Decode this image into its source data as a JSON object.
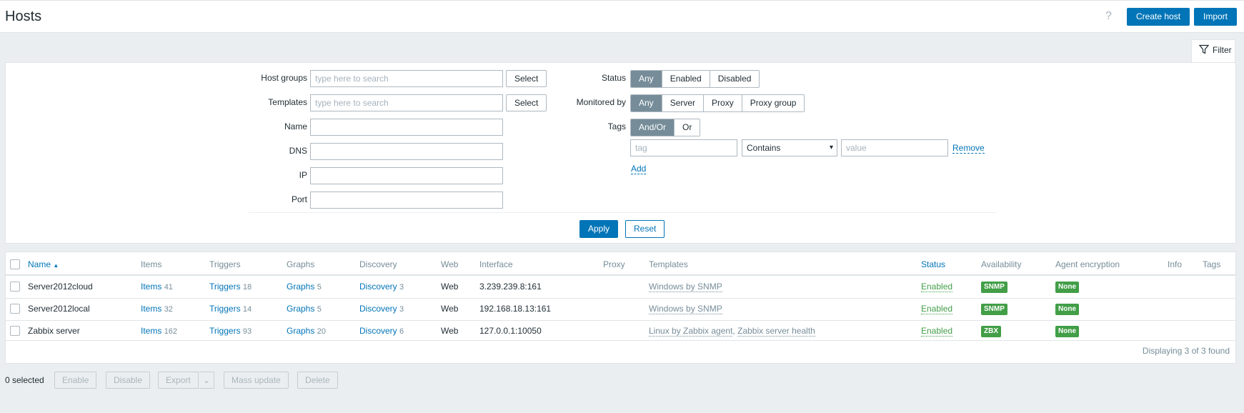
{
  "header": {
    "title": "Hosts",
    "help_glyph": "?",
    "create_host_label": "Create host",
    "import_label": "Import"
  },
  "filter_tab": {
    "label": "Filter"
  },
  "filter": {
    "host_groups_label": "Host groups",
    "host_groups_placeholder": "type here to search",
    "templates_label": "Templates",
    "templates_placeholder": "type here to search",
    "select_label": "Select",
    "name_label": "Name",
    "dns_label": "DNS",
    "ip_label": "IP",
    "port_label": "Port",
    "status_label": "Status",
    "status_options": [
      "Any",
      "Enabled",
      "Disabled"
    ],
    "monitored_by_label": "Monitored by",
    "monitored_by_options": [
      "Any",
      "Server",
      "Proxy",
      "Proxy group"
    ],
    "tags_label": "Tags",
    "tags_options": [
      "And/Or",
      "Or"
    ],
    "tag_placeholder": "tag",
    "operator_value": "Contains",
    "value_placeholder": "value",
    "remove_label": "Remove",
    "add_label": "Add",
    "apply_label": "Apply",
    "reset_label": "Reset"
  },
  "table": {
    "columns": [
      "Name",
      "Items",
      "Triggers",
      "Graphs",
      "Discovery",
      "Web",
      "Interface",
      "Proxy",
      "Templates",
      "Status",
      "Availability",
      "Agent encryption",
      "Info",
      "Tags"
    ],
    "sort_indicator": "▲",
    "rows": [
      {
        "name": "Server2012cloud",
        "items_label": "Items",
        "items_count": "41",
        "triggers_label": "Triggers",
        "triggers_count": "18",
        "graphs_label": "Graphs",
        "graphs_count": "5",
        "discovery_label": "Discovery",
        "discovery_count": "3",
        "web": "Web",
        "interface": "3.239.239.8:161",
        "template1": "Windows by SNMP",
        "template2": "",
        "status": "Enabled",
        "availability": "SNMP",
        "encryption": "None"
      },
      {
        "name": "Server2012local",
        "items_label": "Items",
        "items_count": "32",
        "triggers_label": "Triggers",
        "triggers_count": "14",
        "graphs_label": "Graphs",
        "graphs_count": "5",
        "discovery_label": "Discovery",
        "discovery_count": "3",
        "web": "Web",
        "interface": "192.168.18.13:161",
        "template1": "Windows by SNMP",
        "template2": "",
        "status": "Enabled",
        "availability": "SNMP",
        "encryption": "None"
      },
      {
        "name": "Zabbix server",
        "items_label": "Items",
        "items_count": "162",
        "triggers_label": "Triggers",
        "triggers_count": "93",
        "graphs_label": "Graphs",
        "graphs_count": "20",
        "discovery_label": "Discovery",
        "discovery_count": "6",
        "web": "Web",
        "interface": "127.0.0.1:10050",
        "template1": "Linux by Zabbix agent",
        "template_separator": ",",
        "template2": "Zabbix server health",
        "status": "Enabled",
        "availability": "ZBX",
        "encryption": "None"
      }
    ],
    "footer": "Displaying 3 of 3 found"
  },
  "actions": {
    "selected": "0 selected",
    "enable": "Enable",
    "disable": "Disable",
    "export": "Export",
    "mass_update": "Mass update",
    "delete": "Delete"
  },
  "colors": {
    "accent": "#0275b8",
    "enabled_green": "#429e47",
    "segment_active": "#768d99"
  }
}
